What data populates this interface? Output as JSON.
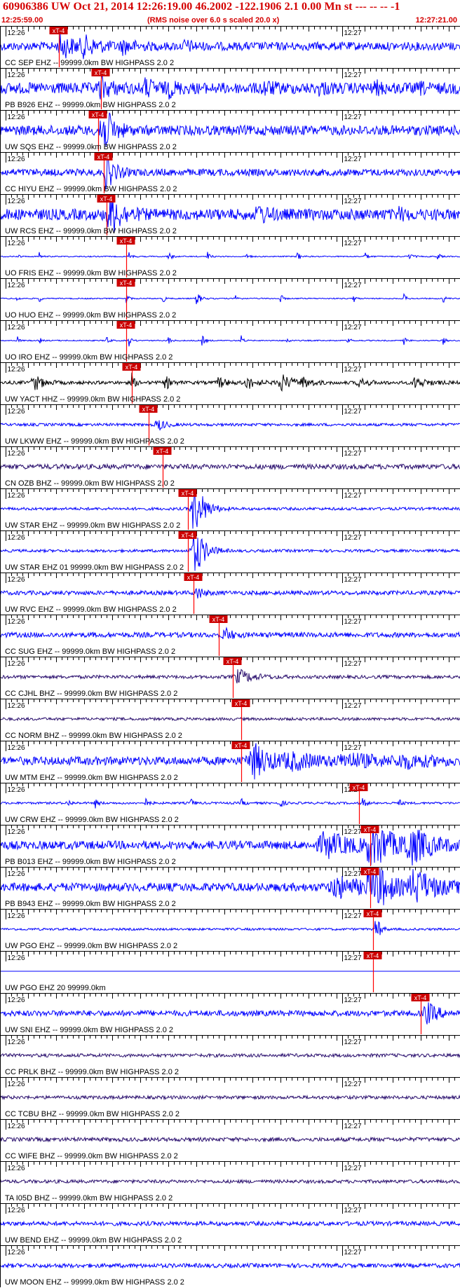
{
  "header": {
    "title": "60906386 UW Oct 21, 2014 12:26:19.00   46.2002 -122.1906  2.1 0.00 Mn st --- -- --   -1",
    "start_time": "12:25:59.00",
    "scale_note": "(RMS noise over 6.0 s scaled 20.0 x)",
    "end_time": "12:27:21.00"
  },
  "chart_data": {
    "type": "line",
    "title": "60906386 UW Oct 21, 2014 12:26:19.00   46.2002 -122.1906  2.1 0.00 Mn st --- -- --   -1",
    "x_axis": {
      "start": "12:25:59.00",
      "end": "12:27:21.00",
      "duration_s": 82,
      "minute_ticks": [
        {
          "label": "12:26",
          "t": 1
        },
        {
          "label": "12:27",
          "t": 61
        }
      ]
    },
    "pick_label": "xT-4",
    "colors": {
      "blue": "#0000ff",
      "black": "#000000",
      "purple": "#2a0f6e",
      "pick": "#ff0000",
      "label_bg": "#cc0000"
    },
    "traces": [
      {
        "label": "CC SEP EHZ -- 99999.0km BW  HIGHPASS  2.0  2",
        "pick_s": 10.5,
        "color": "blue",
        "noise": 0.3,
        "bursts": [
          [
            11,
            0.8,
            2.2
          ],
          [
            15,
            0.5,
            2.8
          ],
          [
            22,
            0.4,
            1.8
          ],
          [
            33,
            0.3,
            1.5
          ]
        ]
      },
      {
        "label": "PB B926 EHZ -- 99999.0km BW  HIGHPASS  2.0  2",
        "pick_s": 18.0,
        "color": "blue",
        "noise": 0.4,
        "bursts": [
          [
            18,
            0.6,
            1.8
          ],
          [
            26,
            0.5,
            1.6
          ],
          [
            30,
            0.4,
            1.5
          ],
          [
            47,
            0.4,
            1.5
          ],
          [
            57,
            0.3,
            1.2
          ],
          [
            67,
            0.3,
            1.2
          ],
          [
            75,
            0.2,
            1
          ]
        ]
      },
      {
        "label": "UW SQS EHZ -- 99999.0km BW  HIGHPASS  2.0  2",
        "pick_s": 17.5,
        "color": "blue",
        "noise": 0.35,
        "bursts": [
          [
            18,
            2.5,
            1.5
          ]
        ]
      },
      {
        "label": "CC HIYU EHZ -- 99999.0km BW  HIGHPASS  2.0  2",
        "pick_s": 18.5,
        "color": "blue",
        "noise": 0.25,
        "bursts": [
          [
            19,
            1.2,
            1.4
          ]
        ]
      },
      {
        "label": "UW RCS EHZ -- 99999.0km BW  HIGHPASS  2.0  2",
        "pick_s": 19.0,
        "color": "blue",
        "noise": 0.4,
        "bursts": [
          [
            19.5,
            1.6,
            1.8
          ],
          [
            46,
            0.6,
            1.5
          ],
          [
            71,
            0.3,
            1.2
          ]
        ]
      },
      {
        "label": "UO FRIS EHZ -- 99999.0km BW  HIGHPASS  2.0  2",
        "pick_s": 22.5,
        "color": "blue",
        "noise": 0.04,
        "bursts": [
          [
            3,
            0.35,
            0.3
          ],
          [
            7,
            0.3,
            0.3
          ],
          [
            23,
            0.4,
            0.4
          ],
          [
            30,
            0.4,
            0.5
          ],
          [
            37,
            0.35,
            0.4
          ],
          [
            44,
            0.35,
            0.4
          ],
          [
            53,
            0.35,
            0.5
          ],
          [
            65,
            0.3,
            0.5
          ],
          [
            73,
            0.3,
            0.5
          ],
          [
            78,
            0.3,
            0.4
          ]
        ]
      },
      {
        "label": "UO HUO EHZ -- 99999.0km BW  HIGHPASS  2.0  2",
        "pick_s": 22.5,
        "color": "blue",
        "noise": 0.04,
        "bursts": [
          [
            3,
            0.35,
            0.3
          ],
          [
            7,
            0.3,
            0.3
          ],
          [
            22.5,
            0.4,
            0.4
          ],
          [
            29,
            0.35,
            0.4
          ],
          [
            35,
            0.5,
            0.7
          ],
          [
            42,
            0.35,
            0.4
          ],
          [
            50,
            0.35,
            0.4
          ],
          [
            63,
            0.3,
            0.4
          ],
          [
            72,
            0.3,
            0.4
          ],
          [
            79,
            0.3,
            0.4
          ]
        ]
      },
      {
        "label": "UO IRO EHZ -- 99999.0km BW  HIGHPASS  2.0  2",
        "pick_s": 22.5,
        "color": "blue",
        "noise": 0.04,
        "bursts": [
          [
            3,
            0.4,
            0.3
          ],
          [
            7,
            0.35,
            0.3
          ],
          [
            19,
            0.4,
            0.4
          ],
          [
            23,
            0.4,
            0.4
          ],
          [
            30,
            0.35,
            0.4
          ],
          [
            36,
            0.4,
            0.5
          ],
          [
            43,
            0.35,
            0.4
          ],
          [
            51,
            0.35,
            0.4
          ],
          [
            62,
            0.3,
            0.4
          ],
          [
            72,
            0.3,
            0.4
          ],
          [
            79,
            0.3,
            0.4
          ]
        ]
      },
      {
        "label": "UW YACT HHZ -- 99999.0km BW  HIGHPASS  2.0  2",
        "pick_s": 23.5,
        "color": "black",
        "noise": 0.12,
        "bursts": [
          [
            6,
            0.6,
            1.5
          ],
          [
            23.5,
            0.6,
            0.5
          ],
          [
            29.5,
            0.5,
            0.8
          ],
          [
            39,
            0.4,
            1.2
          ],
          [
            44,
            0.45,
            1.5
          ],
          [
            50,
            0.6,
            2
          ],
          [
            54,
            0.3,
            1.5
          ],
          [
            64,
            0.3,
            1.5
          ],
          [
            74,
            0.35,
            2
          ]
        ]
      },
      {
        "label": "UW LKWW EHZ -- 99999.0km BW  HIGHPASS  2.0  2",
        "pick_s": 26.5,
        "color": "blue",
        "noise": 0.1,
        "bursts": [
          [
            28,
            0.5,
            1.2
          ]
        ]
      },
      {
        "label": "CN OZB BHZ -- 99999.0km BW  HIGHPASS  2.0  2",
        "pick_s": 29.0,
        "color": "purple",
        "noise": 0.18,
        "bursts": []
      },
      {
        "label": "UW STAR EHZ -- 99999.0km BW  HIGHPASS  2.0  2",
        "pick_s": 33.5,
        "color": "blue",
        "noise": 0.1,
        "bursts": [
          [
            34.5,
            2.4,
            1.6
          ]
        ]
      },
      {
        "label": "UW STAR EHZ 01 99999.0km BW  HIGHPASS  2.0  2",
        "pick_s": 33.5,
        "color": "blue",
        "noise": 0.1,
        "bursts": [
          [
            34.5,
            2.2,
            1.6
          ]
        ]
      },
      {
        "label": "UW RVC EHZ -- 99999.0km BW  HIGHPASS  2.0  2",
        "pick_s": 34.5,
        "color": "blue",
        "noise": 0.15,
        "bursts": [
          [
            35,
            0.5,
            1
          ]
        ]
      },
      {
        "label": "CC SUG EHZ -- 99999.0km BW  HIGHPASS  2.0  2",
        "pick_s": 39.0,
        "color": "blue",
        "noise": 0.18,
        "bursts": [
          [
            40,
            0.5,
            1.2
          ]
        ]
      },
      {
        "label": "CC CJHL BHZ -- 99999.0km BW  HIGHPASS  2.0  2",
        "pick_s": 41.5,
        "color": "purple",
        "noise": 0.12,
        "bursts": [
          [
            42.5,
            0.5,
            2.5
          ]
        ]
      },
      {
        "label": "CC NORM BHZ -- 99999.0km BW  HIGHPASS  2.0  2",
        "pick_s": 43.0,
        "color": "purple",
        "noise": 0.1,
        "bursts": []
      },
      {
        "label": "UW MTM EHZ -- 99999.0km BW  HIGHPASS  2.0  2",
        "pick_s": 43.0,
        "color": "blue",
        "noise": 0.3,
        "bursts": [
          [
            45,
            1.2,
            3
          ],
          [
            52,
            0.4,
            6
          ],
          [
            62,
            0.35,
            6
          ],
          [
            72,
            0.3,
            5
          ]
        ]
      },
      {
        "label": "UW CRW EHZ -- 99999.0km BW  HIGHPASS  2.0  2",
        "pick_s": 64.0,
        "color": "blue",
        "noise": 0.08,
        "bursts": [
          [
            12,
            0.3,
            0.5
          ],
          [
            17,
            0.3,
            0.5
          ],
          [
            26,
            0.3,
            0.5
          ],
          [
            34,
            0.3,
            0.5
          ],
          [
            43,
            0.3,
            0.5
          ],
          [
            50,
            0.3,
            0.5
          ],
          [
            64.5,
            0.4,
            0.6
          ],
          [
            71,
            0.3,
            0.5
          ]
        ]
      },
      {
        "label": "PB B013 EHZ -- 99999.0km BW  HIGHPASS  2.0  2",
        "pick_s": 66.0,
        "color": "blue",
        "noise": 0.3,
        "bursts": [
          [
            58,
            0.8,
            5
          ],
          [
            66,
            2.6,
            2.5
          ],
          [
            73,
            1.2,
            4
          ]
        ]
      },
      {
        "label": "PB B943 EHZ -- 99999.0km BW  HIGHPASS  2.0  2",
        "pick_s": 66.0,
        "color": "blue",
        "noise": 0.3,
        "bursts": [
          [
            60,
            0.7,
            4
          ],
          [
            66,
            2.4,
            2.5
          ],
          [
            74,
            1.1,
            4
          ]
        ]
      },
      {
        "label": "UW PGO EHZ -- 99999.0km BW  HIGHPASS  2.0  2",
        "pick_s": 66.5,
        "color": "blue",
        "noise": 0.08,
        "bursts": [
          [
            67,
            1.3,
            0.6
          ]
        ]
      },
      {
        "label": "UW PGO EHZ 20 99999.0km",
        "pick_s": 66.5,
        "color": "blue",
        "noise": 0,
        "bursts": []
      },
      {
        "label": "UW SNI EHZ -- 99999.0km BW  HIGHPASS  2.0  2",
        "pick_s": 75.0,
        "color": "blue",
        "noise": 0.2,
        "bursts": [
          [
            76,
            0.8,
            1.8
          ]
        ]
      },
      {
        "label": "CC PRLK BHZ -- 99999.0km BW  HIGHPASS  2.0  2",
        "pick_s": null,
        "color": "purple",
        "noise": 0.12,
        "bursts": []
      },
      {
        "label": "CC TCBU BHZ -- 99999.0km BW  HIGHPASS  2.0  2",
        "pick_s": null,
        "color": "purple",
        "noise": 0.12,
        "bursts": []
      },
      {
        "label": "CC WIFE BHZ -- 99999.0km BW  HIGHPASS  2.0  2",
        "pick_s": null,
        "color": "purple",
        "noise": 0.14,
        "bursts": []
      },
      {
        "label": "TA I05D BHZ -- 99999.0km BW  HIGHPASS  2.0  2",
        "pick_s": null,
        "color": "purple",
        "noise": 0.12,
        "bursts": []
      },
      {
        "label": "UW BEND EHZ -- 99999.0km BW  HIGHPASS  2.0  2",
        "pick_s": null,
        "color": "blue",
        "noise": 0.15,
        "bursts": []
      },
      {
        "label": "UW MOON EHZ -- 99999.0km BW  HIGHPASS  2.0  2",
        "pick_s": null,
        "color": "blue",
        "noise": 0.15,
        "bursts": []
      }
    ]
  }
}
